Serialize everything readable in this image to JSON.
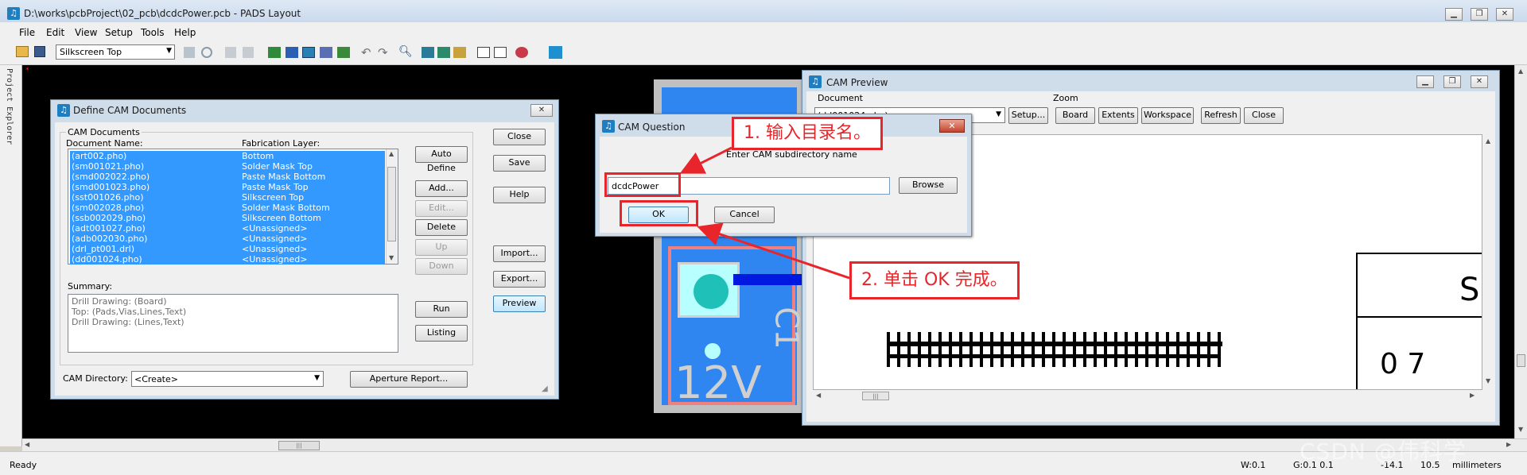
{
  "app": {
    "title": "D:\\works\\pcbProject\\02_pcb\\dcdcPower.pcb - PADS Layout",
    "icon_glyph": "♫",
    "menu": [
      "File",
      "Edit",
      "View",
      "Setup",
      "Tools",
      "Help"
    ],
    "layer_select": "Silkscreen Top",
    "side_tab": "Project Explorer",
    "status_ready": "Ready",
    "status_w": "W:0.1",
    "status_g": "G:0.1 0.1",
    "status_x": "-14.1",
    "status_y": "10.5",
    "status_units": "millimeters",
    "watermark": "CSDN @伟科学"
  },
  "define_cam": {
    "title": "Define CAM Documents",
    "group_label": "CAM Documents",
    "col_doc": "Document Name:",
    "col_layer": "Fabrication Layer:",
    "rows": [
      {
        "name": "(art002.pho)",
        "layer": "Bottom"
      },
      {
        "name": "(sm001021.pho)",
        "layer": "Solder Mask Top"
      },
      {
        "name": "(smd002022.pho)",
        "layer": "Paste Mask Bottom"
      },
      {
        "name": "(smd001023.pho)",
        "layer": "Paste Mask Top"
      },
      {
        "name": "(sst001026.pho)",
        "layer": "Silkscreen Top"
      },
      {
        "name": "(sm002028.pho)",
        "layer": "Solder Mask Bottom"
      },
      {
        "name": "(ssb002029.pho)",
        "layer": "Silkscreen Bottom"
      },
      {
        "name": "(adt001027.pho)",
        "layer": "<Unassigned>"
      },
      {
        "name": "(adb002030.pho)",
        "layer": "<Unassigned>"
      },
      {
        "name": "(drl_pt001.drl)",
        "layer": "<Unassigned>"
      },
      {
        "name": "(dd001024.pho)",
        "layer": "<Unassigned>"
      }
    ],
    "summary_label": "Summary:",
    "summary_lines": [
      "Drill Drawing: (Board)",
      "Top: (Pads,Vias,Lines,Text)",
      "Drill Drawing: (Lines,Text)"
    ],
    "cam_dir_label": "CAM Directory:",
    "cam_dir_value": "<Create>",
    "btn_auto_define": "Auto Define",
    "btn_add": "Add...",
    "btn_edit": "Edit...",
    "btn_delete": "Delete",
    "btn_up": "Up",
    "btn_down": "Down",
    "btn_run": "Run",
    "btn_listing": "Listing",
    "btn_aperture": "Aperture Report...",
    "btn_close": "Close",
    "btn_save": "Save",
    "btn_help": "Help",
    "btn_import": "Import...",
    "btn_export": "Export...",
    "btn_preview": "Preview"
  },
  "cam_question": {
    "title": "CAM Question",
    "prompt": "Enter CAM subdirectory name",
    "input_value": "dcdcPower",
    "btn_browse": "Browse",
    "btn_ok": "OK",
    "btn_cancel": "Cancel"
  },
  "cam_preview": {
    "title": "CAM Preview",
    "document_label": "Document",
    "document_value": "(dd001024.pho)",
    "btn_setup": "Setup...",
    "zoom_label": "Zoom",
    "btn_board": "Board",
    "btn_extents": "Extents",
    "btn_workspace": "Workspace",
    "btn_refresh": "Refresh",
    "btn_close": "Close",
    "preview_text_1": "S",
    "preview_text_2": "0 7"
  },
  "pcb": {
    "label": "12V",
    "label2": "C1"
  },
  "annotations": {
    "step1": "1. 输入目录名。",
    "step2": "2. 单击 OK 完成。"
  }
}
